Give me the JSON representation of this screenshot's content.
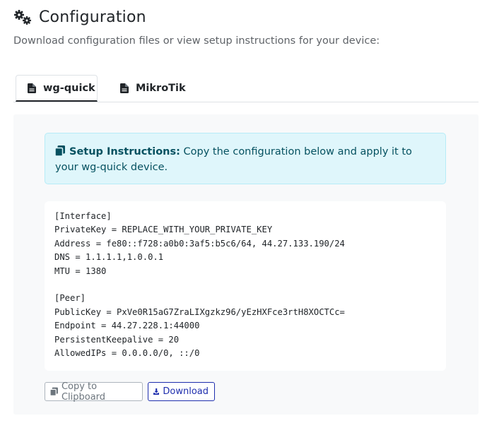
{
  "header": {
    "icon": "gears-icon",
    "title": "Configuration",
    "subtitle": "Download configuration files or view setup instructions for your device:"
  },
  "tabs": [
    {
      "label": "wg-quick",
      "icon": "file-icon",
      "active": true
    },
    {
      "label": "MikroTik",
      "icon": "file-icon",
      "active": false
    }
  ],
  "alert": {
    "icon": "copy-icon",
    "heading": "Setup Instructions:",
    "text": " Copy the configuration below and apply it to your wg-quick device."
  },
  "config": {
    "text": "[Interface]\nPrivateKey = REPLACE_WITH_YOUR_PRIVATE_KEY\nAddress = fe80::f728:a0b0:3af5:b5c6/64, 44.27.133.190/24\nDNS = 1.1.1.1,1.0.0.1\nMTU = 1380\n\n[Peer]\nPublicKey = PxVe0R15aG7ZraLIXgzkz96/yEzHXFce3rtH8XOCTCc=\nEndpoint = 44.27.228.1:44000\nPersistentKeepalive = 20\nAllowedIPs = 0.0.0.0/0, ::/0"
  },
  "buttons": {
    "copy_label": "Copy to Clipboard",
    "download_label": "Download"
  },
  "colors": {
    "alert_bg": "#dff6fb",
    "alert_text": "#055160",
    "download_accent": "#1f2fae"
  }
}
